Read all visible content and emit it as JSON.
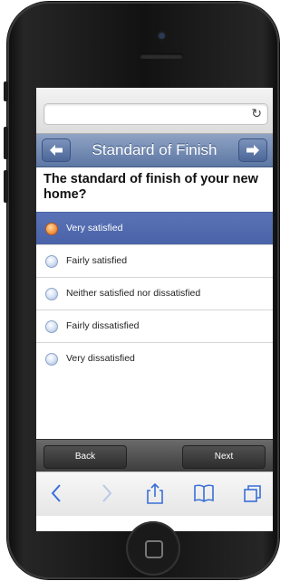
{
  "header": {
    "title": "Standard of Finish",
    "back_icon": "arrow-left-icon",
    "forward_icon": "arrow-right-icon"
  },
  "addressbar": {
    "url": "",
    "reload_icon": "reload-icon",
    "reload_glyph": "↻"
  },
  "question": {
    "text": "The standard of finish of your new home?"
  },
  "options": [
    {
      "label": "Very satisfied",
      "selected": true
    },
    {
      "label": "Fairly satisfied",
      "selected": false
    },
    {
      "label": "Neither satisfied nor dissatisfied",
      "selected": false
    },
    {
      "label": "Fairly dissatisfied",
      "selected": false
    },
    {
      "label": "Very dissatisfied",
      "selected": false
    }
  ],
  "footer": {
    "back_label": "Back",
    "next_label": "Next"
  },
  "toolbar": {
    "icons": [
      "chevron-left-icon",
      "chevron-right-icon",
      "share-icon",
      "bookmarks-icon",
      "tabs-icon"
    ]
  },
  "colors": {
    "header": "#6e86b1",
    "selected_row": "#5068ad",
    "footer": "#4a4a4a",
    "radio_on": "#f08a33"
  }
}
